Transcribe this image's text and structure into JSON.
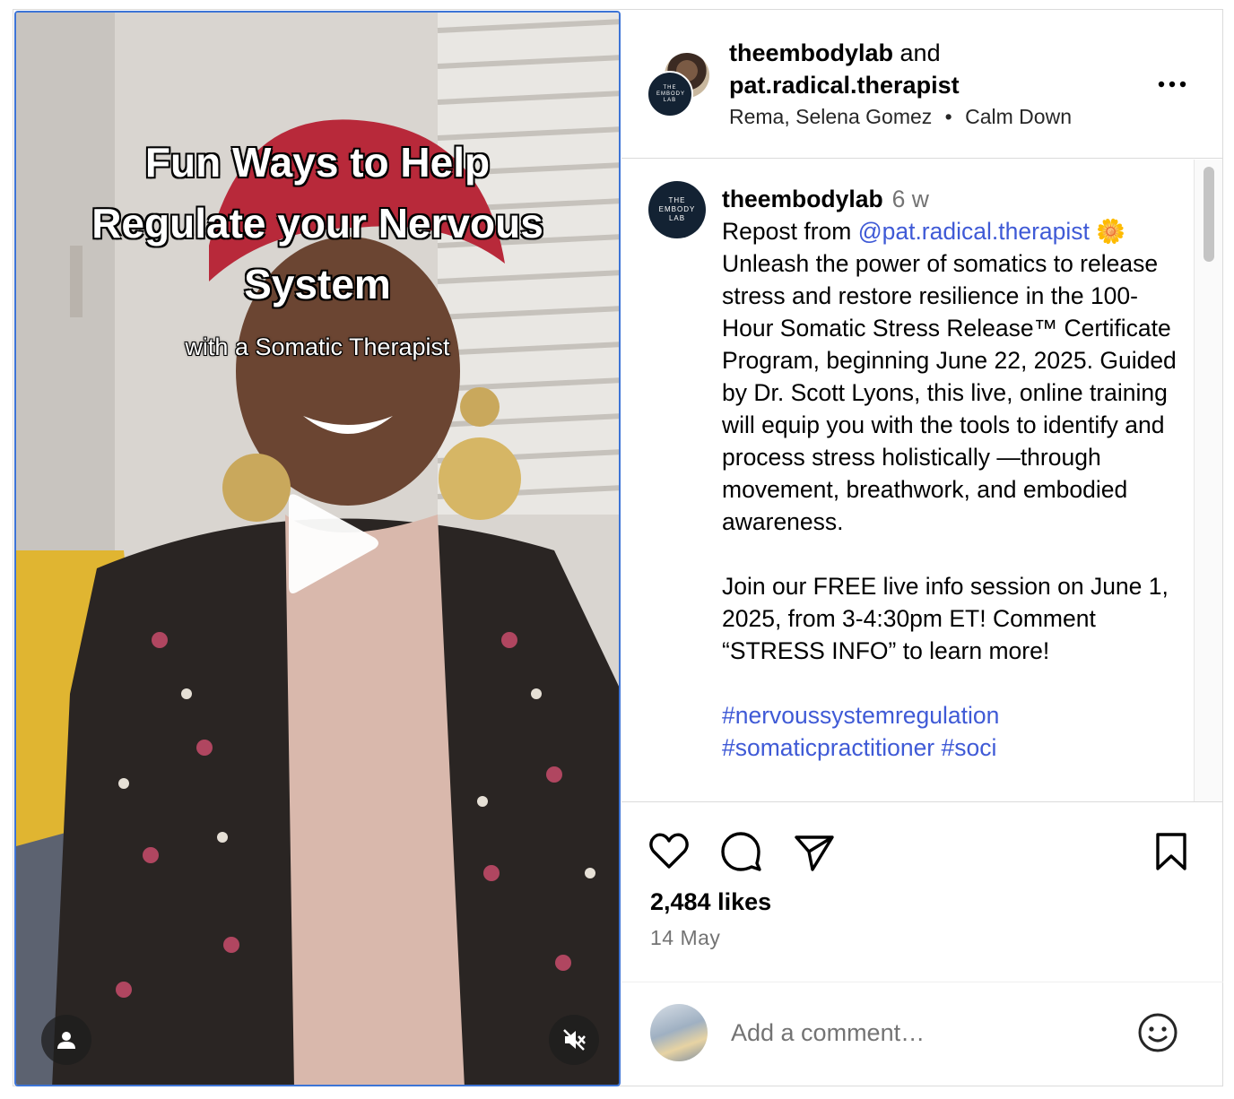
{
  "video": {
    "overlay_title_line1": "Fun Ways to Help",
    "overlay_title_line2": "Regulate your Nervous",
    "overlay_title_line3": "System",
    "overlay_subtitle": "with a Somatic Therapist",
    "muted": true
  },
  "header": {
    "user1": "theembodylab",
    "joiner": " and",
    "user2": "pat.radical.therapist",
    "audio_artists": "Rema, Selena Gomez",
    "audio_separator": "•",
    "audio_track": "Calm Down",
    "logo_text": "THE EMBODY LAB"
  },
  "caption": {
    "username": "theembodylab",
    "time_ago": "6 w",
    "repost_prefix": "Repost from ",
    "repost_handle": "@pat.radical.therapist",
    "flower_emoji": "🌼",
    "paragraph1": "Unleash the power of somatics to release stress and restore resilience in the 100-Hour Somatic Stress Release™ Certificate Program, beginning June 22, 2025. Guided by Dr. Scott Lyons, this live, online training will equip you with the tools to identify and process stress holistically —through movement, breathwork, and embodied awareness.",
    "paragraph2": "Join our FREE live info session on June 1, 2025, from 3-4:30pm ET! Comment “STRESS INFO” to learn more!",
    "hashtag1": "#nervoussystemregulation",
    "hashtag2_partial": "#somaticpractitioner #soci"
  },
  "actions": {
    "likes": "2,484 likes",
    "date": "14 May"
  },
  "comment": {
    "placeholder": "Add a comment…"
  },
  "colors": {
    "link": "#3f5ad6",
    "secondary_text": "#737373",
    "border": "#dbdbdb",
    "video_focus_border": "#3d74d6"
  },
  "icons": [
    "play-icon",
    "user-icon",
    "muted-icon",
    "more-icon",
    "heart-icon",
    "comment-icon",
    "share-icon",
    "bookmark-icon",
    "emoji-icon"
  ]
}
